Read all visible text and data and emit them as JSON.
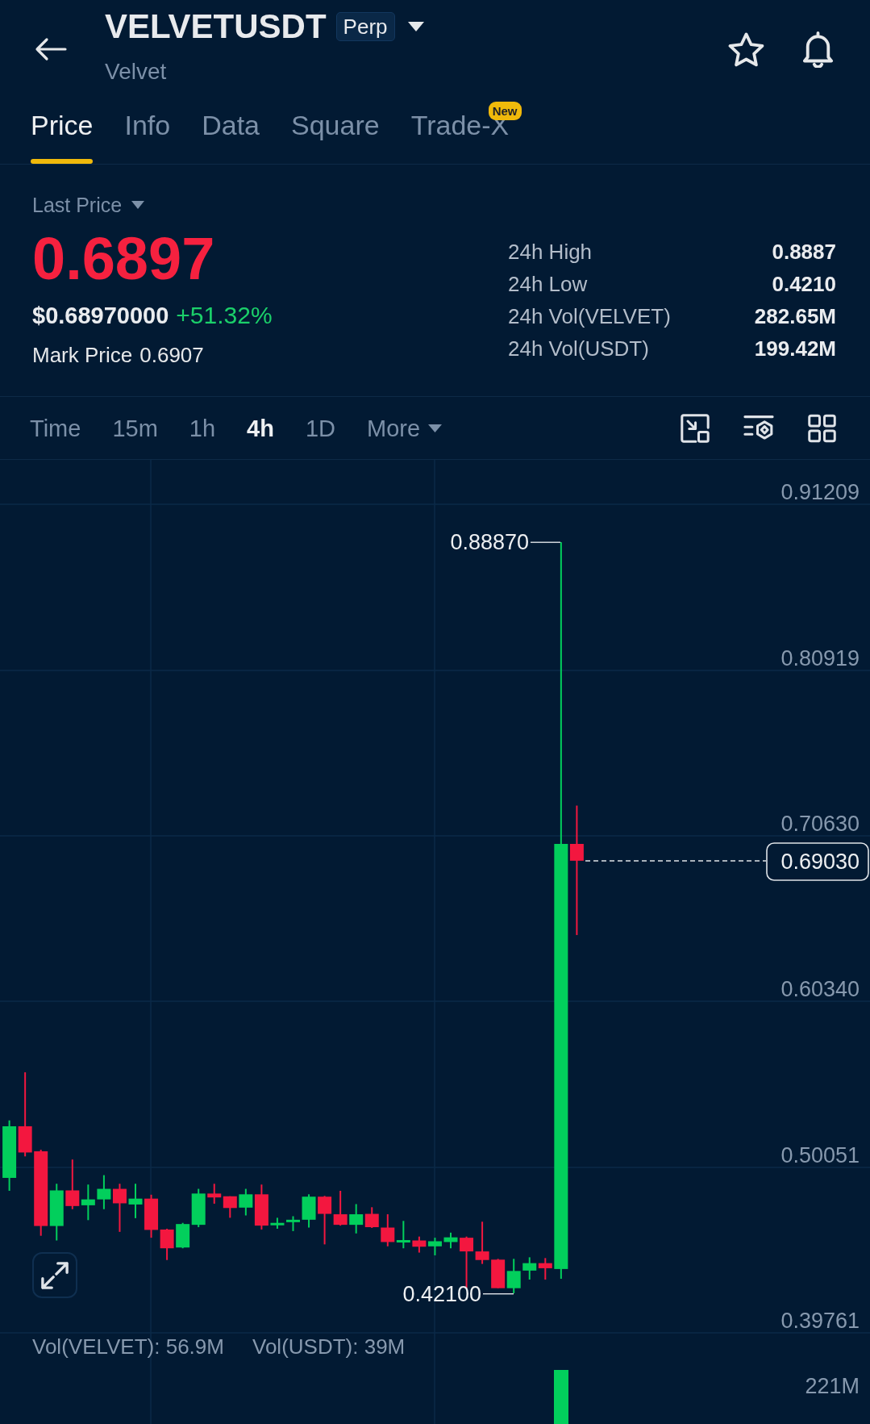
{
  "header": {
    "symbol": "VELVETUSDT",
    "badge": "Perp",
    "subtitle": "Velvet",
    "favorite": false
  },
  "tabs": [
    {
      "label": "Price",
      "selected": true
    },
    {
      "label": "Info",
      "selected": false
    },
    {
      "label": "Data",
      "selected": false
    },
    {
      "label": "Square",
      "selected": false
    },
    {
      "label": "Trade-X",
      "selected": false,
      "badge": "New"
    }
  ],
  "price": {
    "selector": "Last Price",
    "last": "0.6897",
    "usd": "$0.68970000",
    "change": "+51.32%",
    "mark_label": "Mark Price",
    "mark_value": "0.6907"
  },
  "stats": [
    {
      "label": "24h High",
      "value": "0.8887"
    },
    {
      "label": "24h Low",
      "value": "0.4210"
    },
    {
      "label": "24h Vol(VELVET)",
      "value": "282.65M"
    },
    {
      "label": "24h Vol(USDT)",
      "value": "199.42M"
    }
  ],
  "intervals": [
    {
      "label": "Time",
      "kind": "option",
      "selected": false
    },
    {
      "label": "15m",
      "kind": "option",
      "selected": false
    },
    {
      "label": "1h",
      "kind": "option",
      "selected": false
    },
    {
      "label": "4h",
      "kind": "option",
      "selected": true
    },
    {
      "label": "1D",
      "kind": "option",
      "selected": false
    },
    {
      "label": "More",
      "kind": "dropdown",
      "selected": false
    }
  ],
  "chart": {
    "price_axis": [
      "0.91209",
      "0.80919",
      "0.70630",
      "0.60340",
      "0.50051",
      "0.39761"
    ],
    "high_label": "0.88870",
    "low_label": "0.42100",
    "current_price": "0.69030",
    "volume_legend": [
      "Vol(VELVET): 56.9M",
      "Vol(USDT): 39M"
    ],
    "volume_axis": "221M"
  }
}
